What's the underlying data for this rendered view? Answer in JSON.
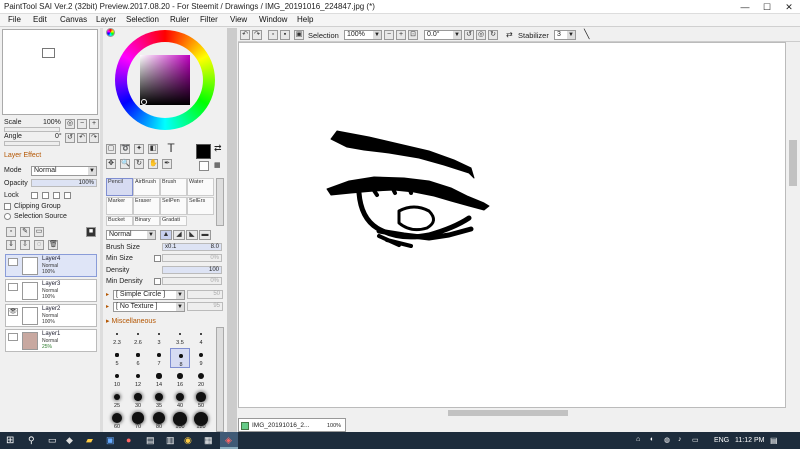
{
  "window": {
    "title": "PaintTool SAI Ver.2 (32bit) Preview.2017.08.20 - For Steemit / Drawings / IMG_20191016_224847.jpg (*)",
    "min": "—",
    "max": "☐",
    "close": "✕"
  },
  "menu": [
    "File",
    "Edit",
    "Canvas",
    "Layer",
    "Selection",
    "Ruler",
    "Filter",
    "View",
    "Window",
    "Help"
  ],
  "navigator": {
    "scale_label": "Scale",
    "scale_value": "100%",
    "angle_label": "Angle",
    "angle_value": "0°"
  },
  "layer_effect": {
    "header": "Layer Effect",
    "mode_label": "Mode",
    "mode_value": "Normal",
    "opacity_label": "Opacity",
    "opacity_value": "100%",
    "lock_label": "Lock",
    "clipping_group": "Clipping Group",
    "selection_source": "Selection Source"
  },
  "layers": [
    {
      "name": "Layer4",
      "mode": "Normal",
      "opacity": "100%",
      "selected": true
    },
    {
      "name": "Layer3",
      "mode": "Normal",
      "opacity": "100%",
      "selected": false
    },
    {
      "name": "Layer2",
      "mode": "Normal",
      "opacity": "100%",
      "selected": false
    },
    {
      "name": "Layer1",
      "mode": "Normal",
      "opacity": "25%",
      "selected": false
    }
  ],
  "tools": {
    "text_tool": "T",
    "brushes": [
      "Pencil",
      "AirBrush",
      "Brush",
      "Water",
      "Marker",
      "Eraser",
      "SelPen",
      "SelErs",
      "Bucket",
      "Binary",
      "Gradati"
    ]
  },
  "brush_settings": {
    "blend_mode": "Normal",
    "brush_size_label": "Brush Size",
    "brush_size_mult": "x0.1",
    "brush_size_value": "8.0",
    "min_size_label": "Min Size",
    "min_size_value": "0%",
    "density_label": "Density",
    "density_value": "100",
    "min_density_label": "Min Density",
    "min_density_value": "0%",
    "shape": "[ Simple Circle ]",
    "shape_value": "50",
    "texture": "[ No Texture ]",
    "texture_value": "95",
    "misc_header": "Miscellaneous"
  },
  "brush_sizes": [
    "2.3",
    "2.6",
    "3",
    "3.5",
    "4",
    "5",
    "6",
    "7",
    "8",
    "9",
    "10",
    "12",
    "14",
    "16",
    "20",
    "25",
    "30",
    "35",
    "40",
    "50",
    "60",
    "70",
    "80",
    "100",
    "120"
  ],
  "toolbar": {
    "selection_label": "Selection",
    "zoom": "100%",
    "angle": "0.0°",
    "stabilizer_label": "Stabilizer",
    "stabilizer_value": "3"
  },
  "doc_tab": {
    "name": "IMG_20191016_2...",
    "zoom": "100%"
  },
  "taskbar": {
    "lang": "ENG",
    "time": "11:12 PM"
  },
  "colors": {
    "accent_section": "#b35500",
    "selected": "#d6dbf2",
    "taskbar": "#1d2c3c"
  }
}
